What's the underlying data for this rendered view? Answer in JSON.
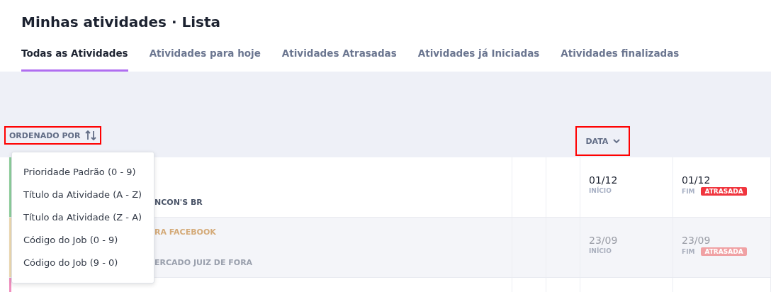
{
  "title": "Minhas atividades · Lista",
  "tabs": [
    {
      "label": "Todas as Atividades",
      "selected": true
    },
    {
      "label": "Atividades para hoje",
      "selected": false
    },
    {
      "label": "Atividades Atrasadas",
      "selected": false
    },
    {
      "label": "Atividades já Iniciadas",
      "selected": false
    },
    {
      "label": "Atividades finalizadas",
      "selected": false
    }
  ],
  "sort": {
    "label": "ORDENADO POR",
    "highlighted": true
  },
  "date_sort": {
    "label": "DATA",
    "highlighted": true
  },
  "sort_menu": [
    "Prioridade Padrão (0 - 9)",
    "Título da Atividade (A - Z)",
    "Título da Atividade (Z - A)",
    "Código do Job (0 - 9)",
    "Código do Job (9 - 0)"
  ],
  "rows": [
    {
      "color": "#8fd19e",
      "muted": false,
      "subtitle": "NCON'S BR",
      "start": "01/12",
      "start_label": "INÍCIO",
      "end": "01/12",
      "end_label": "FIM",
      "badge": "ATRASADA"
    },
    {
      "color": "#f0dcb4",
      "muted": true,
      "category": "RA FACEBOOK",
      "subtitle": "ERCADO JUIZ DE FORA",
      "start": "23/09",
      "start_label": "INÍCIO",
      "end": "23/09",
      "end_label": "FIM",
      "badge": "ATRASADA"
    },
    {
      "color": "#f08fbf"
    }
  ]
}
